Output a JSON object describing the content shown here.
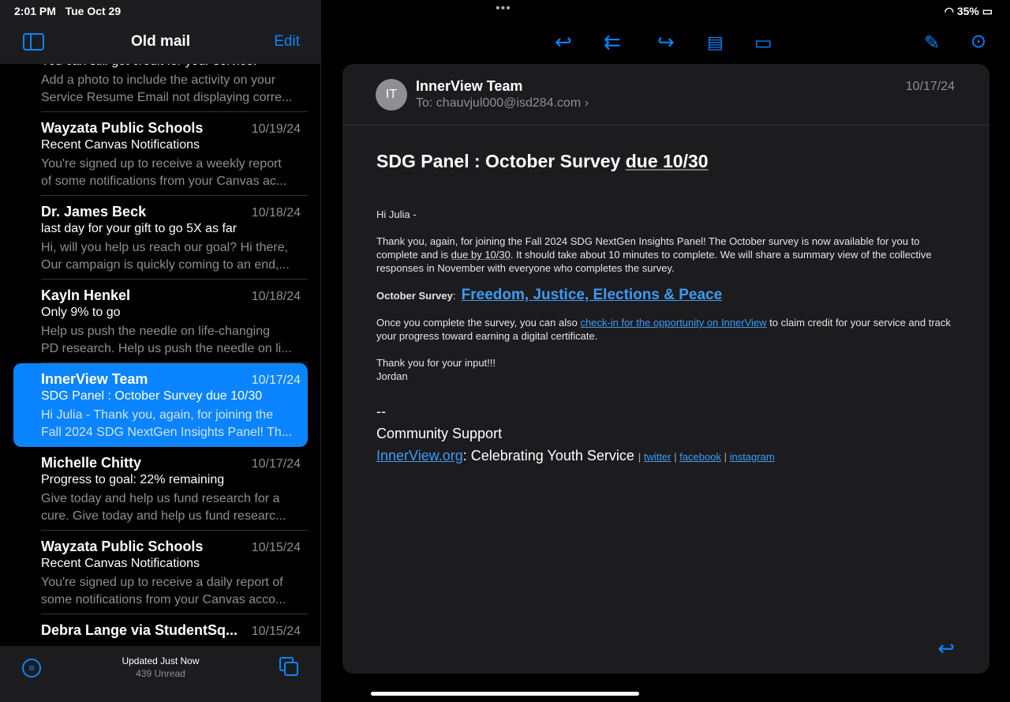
{
  "status": {
    "time": "2:01 PM",
    "date": "Tue Oct 29",
    "battery": "35%"
  },
  "sidebar": {
    "title": "Old mail",
    "edit": "Edit",
    "messages": [
      {
        "sender": "",
        "date": "",
        "subject": "You can still get credit for your service!",
        "preview": [
          "Add a photo to include the activity on your",
          "Service Resume Email not displaying corre..."
        ]
      },
      {
        "sender": "Wayzata Public Schools",
        "date": "10/19/24",
        "subject": "Recent Canvas Notifications",
        "preview": [
          "You're signed up to receive a weekly report",
          "of some notifications from your Canvas ac..."
        ]
      },
      {
        "sender": "Dr. James Beck",
        "date": "10/18/24",
        "subject": "last day for your gift to go 5X as far",
        "preview": [
          "Hi, will you help us reach our goal? Hi there,",
          "Our campaign is quickly coming to an end,..."
        ]
      },
      {
        "sender": "Kayln Henkel",
        "date": "10/18/24",
        "subject": "Only 9% to go",
        "preview": [
          "Help us push the needle on life-changing",
          "PD research. Help us push the needle on li..."
        ]
      },
      {
        "sender": "InnerView Team",
        "date": "10/17/24",
        "subject": "SDG Panel : October Survey due 10/30",
        "preview": [
          "Hi Julia - Thank you, again, for joining the",
          "Fall 2024 SDG NextGen Insights Panel! Th..."
        ]
      },
      {
        "sender": "Michelle Chitty",
        "date": "10/17/24",
        "subject": "Progress to goal: 22% remaining",
        "preview": [
          "Give today and help us fund research for a",
          "cure. Give today and help us fund researc..."
        ]
      },
      {
        "sender": "Wayzata Public Schools",
        "date": "10/15/24",
        "subject": "Recent Canvas Notifications",
        "preview": [
          "You're signed up to receive a daily report of",
          "some notifications from your Canvas acco..."
        ]
      },
      {
        "sender": "Debra Lange via StudentSq...",
        "date": "10/15/24",
        "subject": "",
        "preview": [
          "",
          ""
        ]
      }
    ],
    "footer": {
      "updated": "Updated Just Now",
      "unread": "439 Unread"
    }
  },
  "email": {
    "initials": "IT",
    "from": "InnerView Team",
    "to_label": "To:",
    "to": "chauvjul000@isd284.com",
    "date": "10/17/24",
    "title_a": "SDG Panel : October Survey ",
    "title_b": "due 10/30",
    "greeting": "Hi Julia -",
    "p1a": "Thank you, again, for joining the Fall 2024 SDG NextGen Insights Panel! The October survey is now available for you to complete and is ",
    "p1due": "due by 10/30",
    "p1b": ". It should take about 10 minutes to complete. We will share a summary view of the collective responses in November with everyone who completes the survey.",
    "survey_label": "October Survey",
    "survey_link": "Freedom, Justice, Elections & Peace",
    "p3a": "Once you complete the survey, you can also ",
    "p3link": "check-in for the opportunity on InnerView",
    "p3b": " to claim credit for your service and track your progress toward earning a digital certificate.",
    "thanks": "Thank you for your input!!!",
    "name": "Jordan",
    "dash": "--",
    "org": "Community Support",
    "site": "InnerView.org",
    "tagline": ": Celebrating Youth Service",
    "twitter": "twitter",
    "facebook": "facebook",
    "instagram": "instagram"
  }
}
